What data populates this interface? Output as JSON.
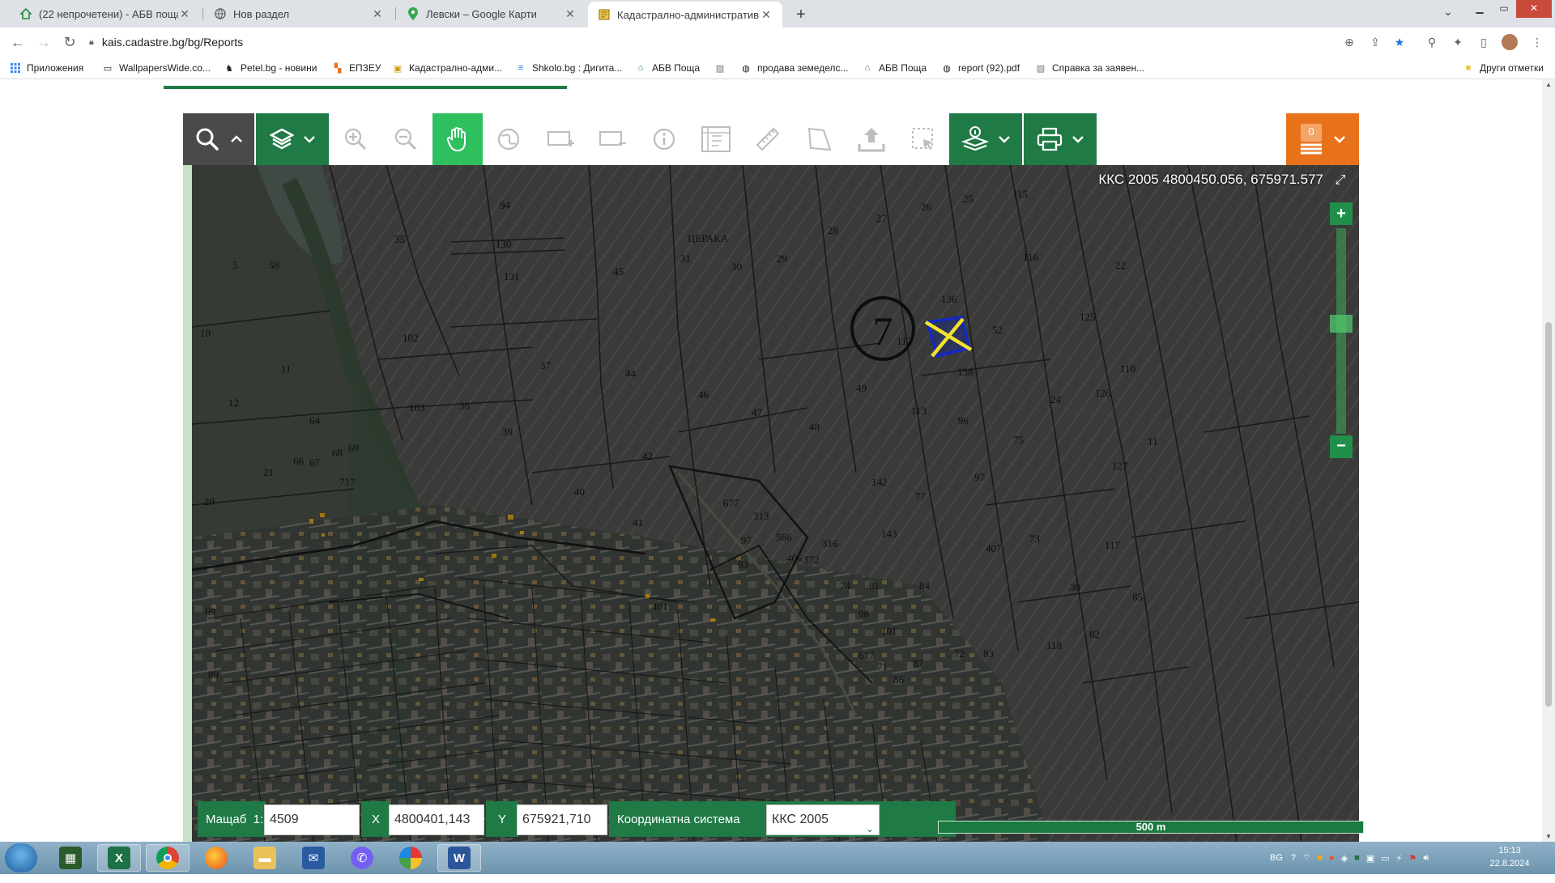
{
  "browser": {
    "tabs": [
      {
        "title": "(22 непрочетени) - АБВ поща",
        "icon": "abv-house-icon",
        "active": false
      },
      {
        "title": "Нов раздел",
        "icon": "globe-icon",
        "active": false
      },
      {
        "title": "Левски – Google Карти",
        "icon": "map-pin-icon",
        "active": false
      },
      {
        "title": "Кадастрално-административна",
        "icon": "cadastre-icon",
        "active": true
      }
    ],
    "url": "kais.cadastre.bg/bg/Reports",
    "bookmarks": [
      {
        "label": "Приложения",
        "icon": "apps-grid-icon"
      },
      {
        "label": "WallpapersWide.co...",
        "icon": "monitor-icon"
      },
      {
        "label": "Petel.bg - новини",
        "icon": "rooster-icon"
      },
      {
        "label": "ЕПЗЕУ",
        "icon": "epzeu-icon"
      },
      {
        "label": "Кадастрално-адми...",
        "icon": "cadastre-icon"
      },
      {
        "label": "Shkolo.bg : Дигита...",
        "icon": "shkolo-icon"
      },
      {
        "label": "АБВ Поща",
        "icon": "abv-house-icon"
      },
      {
        "label": "",
        "icon": "image-icon"
      },
      {
        "label": "продава земеделс...",
        "icon": "globe-icon"
      },
      {
        "label": "АБВ Поща",
        "icon": "abv-house-icon"
      },
      {
        "label": "report (92).pdf",
        "icon": "globe-icon"
      },
      {
        "label": "Справка за заявен...",
        "icon": "image-icon"
      }
    ],
    "other_bookmarks": "Други отметки"
  },
  "map": {
    "toolbar": {
      "counter": "0",
      "buttons": [
        "search-icon",
        "collapse-icon",
        "layers-icon",
        "zoom-in-icon",
        "zoom-out-icon",
        "pan-hand-icon",
        "globe-icon",
        "add-frame-icon",
        "remove-frame-icon",
        "info-icon",
        "measure-grid-icon",
        "ruler-icon",
        "polygon-icon",
        "upload-icon",
        "select-area-icon",
        "info-layers-icon",
        "print-icon",
        "list-icon"
      ]
    },
    "coords_readout": "ККС 2005 4800450.056, 675971.577",
    "zoom_level_fraction": 0.54,
    "locality_label": "ЦЕРАКА",
    "marker_label": "7",
    "scale_bar": "500 m",
    "parcel_labels": [
      "94",
      "35",
      "130",
      "131",
      "45",
      "31",
      "30",
      "29",
      "28",
      "27",
      "26",
      "25",
      "115",
      "116",
      "22",
      "5",
      "58",
      "136",
      "52",
      "125",
      "10",
      "102",
      "112",
      "138",
      "110",
      "11",
      "37",
      "44",
      "46",
      "49",
      "113",
      "24",
      "126",
      "12",
      "103",
      "38",
      "47",
      "48",
      "96",
      "75",
      "11",
      "64",
      "39",
      "42",
      "127",
      "21",
      "67",
      "68",
      "69",
      "142",
      "97",
      "20",
      "66",
      "717",
      "40",
      "677",
      "77",
      "313",
      "41",
      "143",
      "73",
      "117",
      "97",
      "566",
      "316",
      "93",
      "406",
      "372",
      "407",
      "74",
      "81",
      "84",
      "85",
      "69",
      "30",
      "401",
      "98",
      "617",
      "101",
      "82",
      "83",
      "118",
      "72",
      "71",
      "86",
      "87",
      "89",
      "31"
    ],
    "bottom": {
      "scale_label": "Мащаб",
      "scale_prefix": "1:",
      "scale_value": "4509",
      "x_label": "X",
      "x_value": "4800401,143",
      "y_label": "Y",
      "y_value": "675921,710",
      "crs_label": "Координатна система",
      "crs_value": "ККС 2005"
    }
  },
  "taskbar": {
    "apps": [
      "windows-start-icon",
      "task-manager-icon",
      "excel-icon",
      "chrome-icon",
      "firefox-icon",
      "explorer-folder-icon",
      "outlook-icon",
      "viber-icon",
      "picasa-icon",
      "word-icon"
    ],
    "tray_lang": "BG",
    "time": "15:13",
    "date": "22.8.2024 г."
  }
}
